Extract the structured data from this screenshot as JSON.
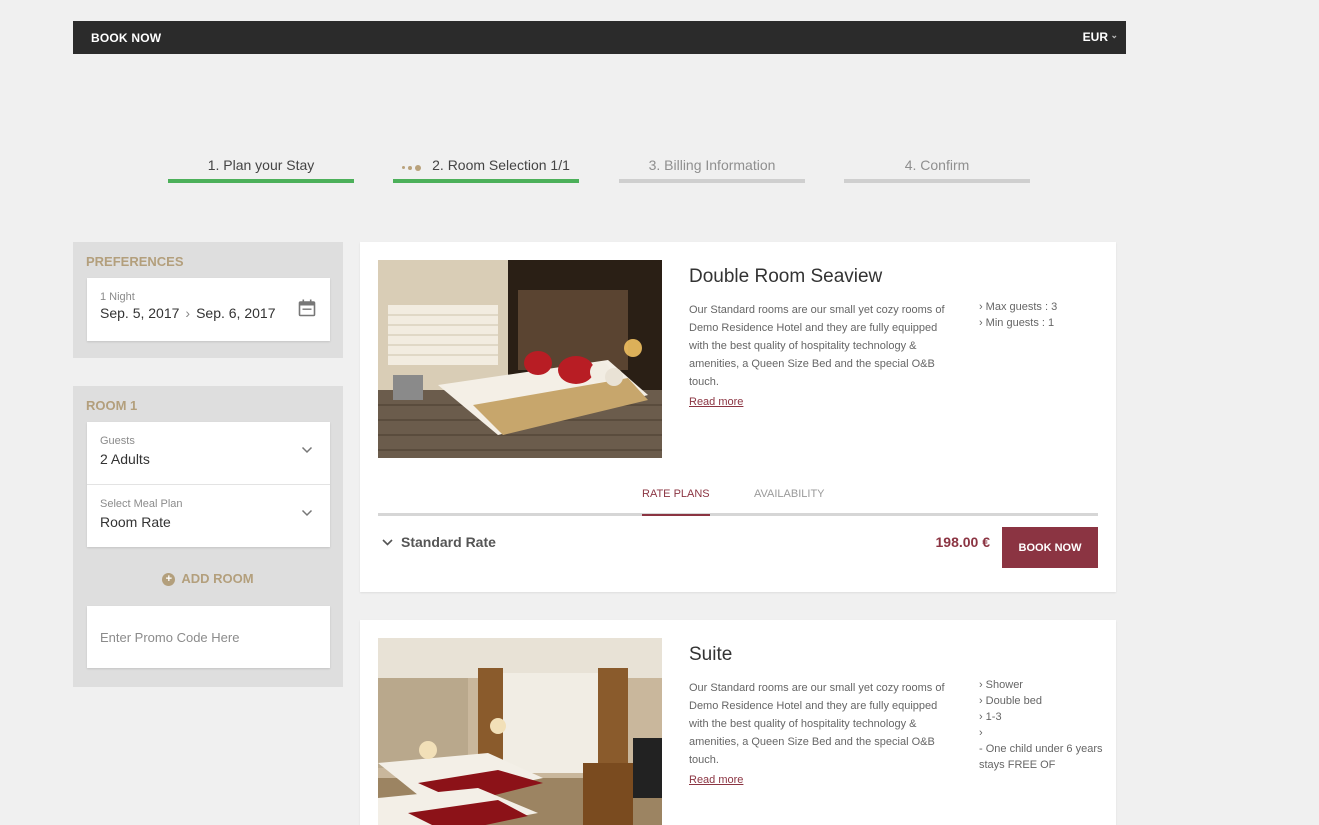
{
  "topbar": {
    "book_now": "BOOK NOW",
    "currency": "EUR"
  },
  "steps": [
    {
      "label": "1. Plan your Stay",
      "state": "done"
    },
    {
      "label": "2. Room Selection 1/1",
      "state": "current"
    },
    {
      "label": "3. Billing Information",
      "state": "todo"
    },
    {
      "label": "4. Confirm",
      "state": "todo"
    }
  ],
  "preferences": {
    "title": "PREFERENCES",
    "nights": "1 Night",
    "checkin": "Sep. 5, 2017",
    "checkout": "Sep. 6, 2017",
    "icon": "calendar-icon"
  },
  "room_panel": {
    "title": "ROOM 1",
    "guests_label": "Guests",
    "guests_value": "2 Adults",
    "meal_label": "Select Meal Plan",
    "meal_value": "Room Rate",
    "add_room": "ADD ROOM",
    "promo_placeholder": "Enter Promo Code Here"
  },
  "rooms": [
    {
      "title": "Double Room Seaview",
      "description": "Our Standard rooms are our small yet cozy rooms of Demo Residence Hotel and they are fully equipped with the best quality of hospitality technology & amenities, a Queen Size Bed and the special O&B touch.",
      "read_more": "Read more",
      "amenities": [
        "Max guests : 3",
        "Min guests : 1"
      ],
      "tabs": [
        "RATE PLANS",
        "AVAILABILITY"
      ],
      "rate": {
        "name": "Standard Rate",
        "price": "198.00 €",
        "button": "BOOK NOW"
      }
    },
    {
      "title": "Suite",
      "description": "Our Standard rooms are our small yet cozy rooms of Demo Residence Hotel and they are fully equipped with the best quality of hospitality technology & amenities, a Queen Size Bed and the special O&B touch.",
      "read_more": "Read more",
      "amenities": [
        "Shower",
        "Double bed",
        "1-3",
        "",
        "- One child under 6 years stays FREE OF"
      ]
    }
  ],
  "colors": {
    "accent": "#8b3442",
    "gold": "#b39f7c",
    "green": "#4cb05a",
    "topbar": "#2b2b2b"
  }
}
